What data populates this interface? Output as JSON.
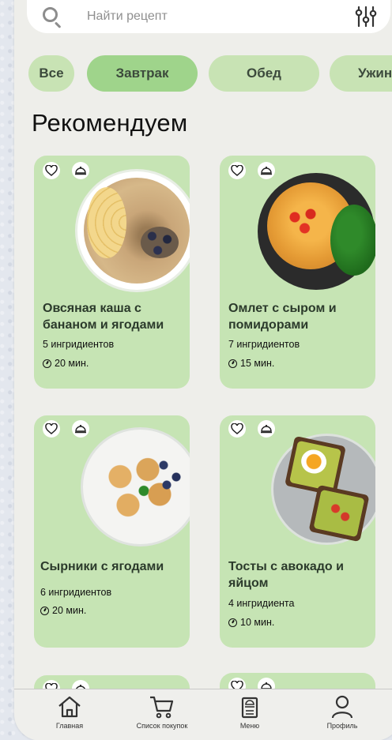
{
  "search": {
    "placeholder": "Найти рецепт"
  },
  "categories": [
    {
      "label": "Все",
      "active": false
    },
    {
      "label": "Завтрак",
      "active": true
    },
    {
      "label": "Обед",
      "active": false
    },
    {
      "label": "Ужин",
      "active": false
    }
  ],
  "section_title": "Рекомендуем",
  "recipes": [
    {
      "title": "Овсяная каша с бананом и ягодами",
      "ingredients": "5 ингридиентов",
      "time": "20 мин."
    },
    {
      "title": "Омлет с сыром и помидорами",
      "ingredients": "7 ингридиентов",
      "time": "15 мин."
    },
    {
      "title": "Сырники с ягодами",
      "ingredients": "6 ингридиентов",
      "time": "20 мин."
    },
    {
      "title": "Тосты с авокадо и яйцом",
      "ingredients": "4 ингридиента",
      "time": "10 мин."
    }
  ],
  "nav": {
    "home": "Главная",
    "shopping": "Список покупок",
    "menu": "Меню",
    "profile": "Профиль"
  },
  "colors": {
    "card": "#c6e4b4",
    "chip": "#c8e3b4",
    "chip_active": "#9fd48b"
  }
}
